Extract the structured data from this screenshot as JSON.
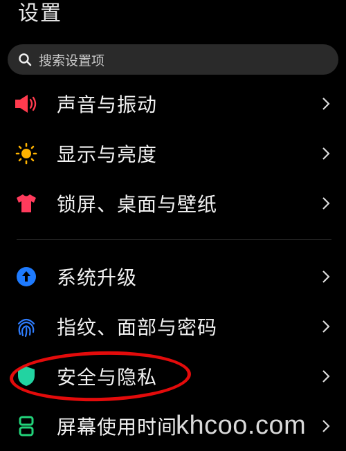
{
  "page_title": "设置",
  "search": {
    "placeholder": "搜索设置项",
    "icon": "search-icon"
  },
  "items": [
    {
      "label": "声音与振动",
      "icon": "speaker-icon",
      "color": "#ff3b4e"
    },
    {
      "label": "显示与亮度",
      "icon": "sun-icon",
      "color": "#ffb300"
    },
    {
      "label": "锁屏、桌面与壁纸",
      "icon": "tshirt-icon",
      "color": "#ff3b5c"
    },
    {
      "label": "系统升级",
      "icon": "upgrade-arrow-icon",
      "color": "#1e7bff"
    },
    {
      "label": "指纹、面部与密码",
      "icon": "fingerprint-icon",
      "color": "#2e7dff"
    },
    {
      "label": "安全与隐私",
      "icon": "shield-icon",
      "color": "#22d3a1"
    },
    {
      "label": "屏幕使用时间",
      "icon": "hourglass-icon",
      "color": "#22d37a"
    }
  ],
  "annotation": {
    "color": "#e30b0b"
  },
  "watermark": "khcoo.com"
}
